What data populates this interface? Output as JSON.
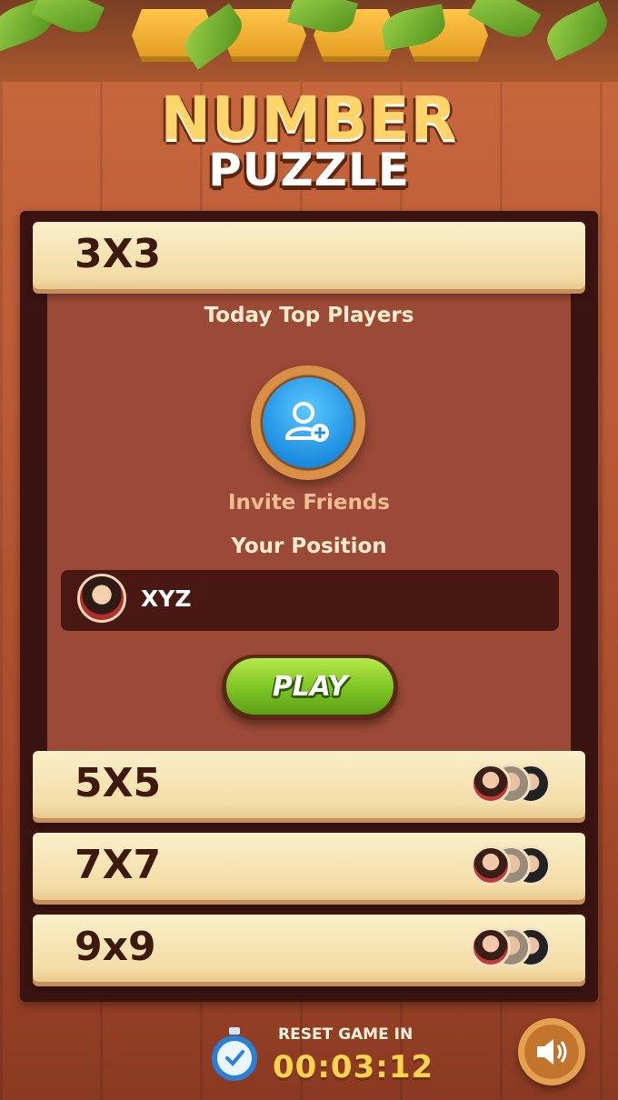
{
  "app": {
    "title_line1": "NUMBER",
    "title_line2": "PUZZLE"
  },
  "levels": [
    {
      "label": "3X3",
      "expanded": true
    },
    {
      "label": "5X5",
      "expanded": false
    },
    {
      "label": "7X7",
      "expanded": false
    },
    {
      "label": "9x9",
      "expanded": false
    }
  ],
  "expanded_panel": {
    "top_players_heading": "Today Top Players",
    "invite_label": "Invite Friends",
    "your_position_heading": "Your Position",
    "player_name": "XYZ",
    "play_label": "PLAY"
  },
  "footer": {
    "reset_label": "RESET GAME IN",
    "reset_time": "00:03:12"
  },
  "icons": {
    "invite": "add-user-icon",
    "timer": "stopwatch-icon",
    "sound": "speaker-icon"
  },
  "colors": {
    "background": "#b95a35",
    "panel": "#9a4a36",
    "level_bar": "#f3dca7",
    "play_button": "#7cc423",
    "invite_button": "#1d8ee0",
    "timer_text": "#ffd34d"
  }
}
